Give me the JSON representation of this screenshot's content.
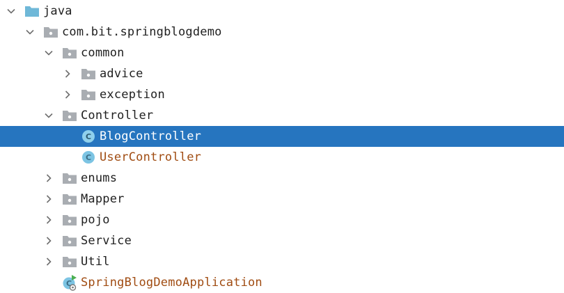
{
  "tree": {
    "rows": [
      {
        "label": "java",
        "level": 0,
        "expanded": true,
        "has_chevron": true,
        "icon": "source-folder-icon",
        "color": "normal"
      },
      {
        "label": "com.bit.springblogdemo",
        "level": 1,
        "expanded": true,
        "has_chevron": true,
        "icon": "package-icon",
        "color": "normal"
      },
      {
        "label": "common",
        "level": 2,
        "expanded": true,
        "has_chevron": true,
        "icon": "package-icon",
        "color": "normal"
      },
      {
        "label": "advice",
        "level": 3,
        "expanded": false,
        "has_chevron": true,
        "icon": "package-icon",
        "color": "normal"
      },
      {
        "label": "exception",
        "level": 3,
        "expanded": false,
        "has_chevron": true,
        "icon": "package-icon",
        "color": "normal"
      },
      {
        "label": "Controller",
        "level": 2,
        "expanded": true,
        "has_chevron": true,
        "icon": "package-icon",
        "color": "normal"
      },
      {
        "label": "BlogController",
        "level": 3,
        "has_chevron": false,
        "icon": "class-icon",
        "color": "modified",
        "selected": true
      },
      {
        "label": "UserController",
        "level": 3,
        "has_chevron": false,
        "icon": "class-icon",
        "color": "modified"
      },
      {
        "label": "enums",
        "level": 2,
        "expanded": false,
        "has_chevron": true,
        "icon": "package-icon",
        "color": "normal"
      },
      {
        "label": "Mapper",
        "level": 2,
        "expanded": false,
        "has_chevron": true,
        "icon": "package-icon",
        "color": "normal"
      },
      {
        "label": "pojo",
        "level": 2,
        "expanded": false,
        "has_chevron": true,
        "icon": "package-icon",
        "color": "normal"
      },
      {
        "label": "Service",
        "level": 2,
        "expanded": false,
        "has_chevron": true,
        "icon": "package-icon",
        "color": "normal"
      },
      {
        "label": "Util",
        "level": 2,
        "expanded": false,
        "has_chevron": true,
        "icon": "package-icon",
        "color": "normal"
      },
      {
        "label": "SpringBlogDemoApplication",
        "level": 2,
        "has_chevron": false,
        "icon": "spring-boot-application-icon",
        "color": "modified"
      }
    ],
    "class_icon_letter": "C"
  },
  "colors": {
    "selection": "#2675bf",
    "modified_text": "#a04c12",
    "source_folder": "#6fb8d8",
    "package_folder": "#a9adb2",
    "class_icon": "#7cc4e3",
    "app_badge": "#4caf50"
  }
}
